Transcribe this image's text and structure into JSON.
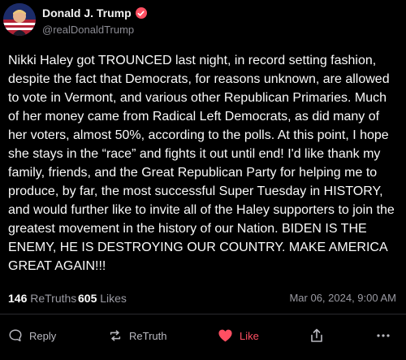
{
  "post": {
    "author_name": "Donald J. Trump",
    "handle": "@realDonaldTrump",
    "body": "Nikki Haley got TROUNCED last night, in record setting fashion, despite the fact that Democrats, for reasons unknown, are allowed to vote in Vermont, and various other Republican Primaries. Much of her money came from Radical Left Democrats, as did many of her voters, almost 50%, according to the polls. At this point, I hope she stays in the “race” and fights it out until end! I'd like thank my family, friends, and the Great Republican Party for helping me to produce, by far, the most successful Super Tuesday in HISTORY, and would further like to invite all of the Haley supporters to join the greatest movement in the history of our Nation. BIDEN IS THE ENEMY, HE IS DESTROYING OUR COUNTRY. MAKE AMERICA GREAT AGAIN!!!",
    "retruths_count": "146",
    "retruths_label": "ReTruths",
    "likes_count": "605",
    "likes_label": "Likes",
    "timestamp": "Mar 06, 2024, 9:00 AM"
  },
  "actions": {
    "reply_label": "Reply",
    "retruth_label": "ReTruth",
    "like_label": "Like"
  },
  "icons": {
    "verified": "verified-badge-icon",
    "reply": "speech-bubble-icon",
    "retruth": "retruth-arrows-icon",
    "like": "heart-icon",
    "share": "share-icon",
    "more": "more-dots-icon"
  },
  "colors": {
    "background": "#000000",
    "accent": "#ff4f62",
    "muted": "#9a9aa2"
  }
}
